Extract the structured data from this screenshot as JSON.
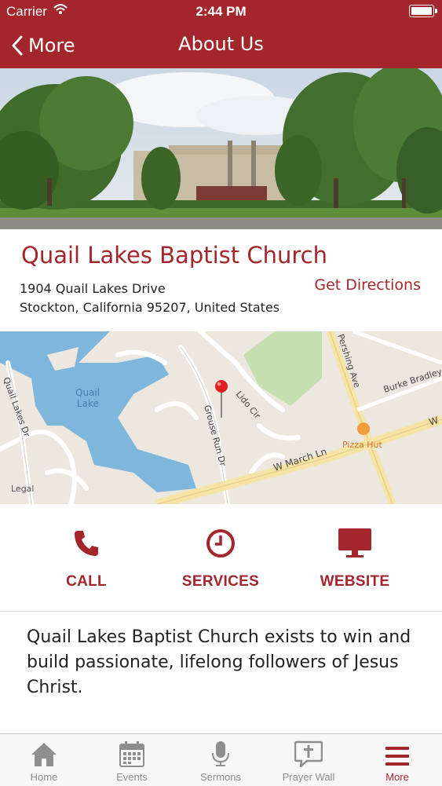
{
  "status_bar": {
    "carrier": "Carrier",
    "time": "2:44 PM"
  },
  "nav": {
    "back_label": "More",
    "title": "About Us"
  },
  "church": {
    "name": "Quail Lakes Baptist Church",
    "address_line1": "1904 Quail Lakes Drive",
    "address_line2": "Stockton, California 95207, United States",
    "directions_label": "Get Directions"
  },
  "map": {
    "labels": {
      "lake": "Quail Lake",
      "quail_lakes_dr": "Quail Lakes Dr",
      "grouse_run_dr": "Grouse Run Dr",
      "lido_cir": "Lido Cir",
      "pershing_ave": "Pershing Ave",
      "burke_bradley": "Burke Bradley",
      "w_march_ln": "W March Ln",
      "w_partial": "W",
      "pizza_hut": "Pizza Hut",
      "legal": "Legal"
    }
  },
  "actions": [
    {
      "label": "CALL",
      "icon": "phone-icon"
    },
    {
      "label": "SERVICES",
      "icon": "clock-icon"
    },
    {
      "label": "WEBSITE",
      "icon": "monitor-icon"
    }
  ],
  "description": "Quail Lakes Baptist Church exists to win and build passionate, lifelong followers of Jesus Christ.",
  "tabs": [
    {
      "label": "Home",
      "icon": "home-icon",
      "active": false
    },
    {
      "label": "Events",
      "icon": "calendar-icon",
      "active": false
    },
    {
      "label": "Sermons",
      "icon": "microphone-icon",
      "active": false
    },
    {
      "label": "Prayer Wall",
      "icon": "prayer-bubble-icon",
      "active": false
    },
    {
      "label": "More",
      "icon": "menu-icon",
      "active": true
    }
  ],
  "colors": {
    "brand": "#a3262c",
    "tab_inactive": "#8e8e8e",
    "map_water": "#7fb6dc",
    "map_park": "#c5dfb0"
  }
}
